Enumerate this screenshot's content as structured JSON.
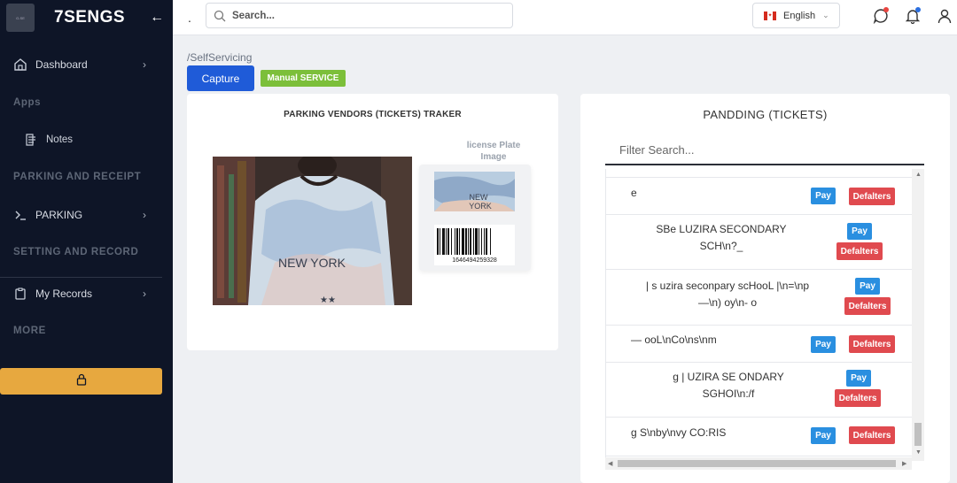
{
  "sidebar": {
    "brand": "7SENGS",
    "logo_text": "G-SE",
    "items": [
      {
        "label": "Dashboard"
      },
      {
        "label": "PARKING"
      },
      {
        "label": "My Records"
      }
    ],
    "sections": [
      "Apps",
      "PARKING AND RECEIPT",
      "SETTING AND RECORD",
      "MORE"
    ],
    "sub_items": [
      {
        "label": "Notes"
      }
    ]
  },
  "topbar": {
    "dot": ".",
    "search_placeholder": "Search...",
    "language": "English"
  },
  "main": {
    "breadcrumb": "/SelfServicing",
    "capture_label": "Capture",
    "manual_label": "Manual SERVICE",
    "left_card": {
      "title": "PARKING VENDORS (TICKETS) TRAKER",
      "plate_label": "license Plate Image",
      "barcode_number": "1646494259328",
      "shirt_text": "NEW YORK"
    },
    "right_card": {
      "title": "PANDDING (TICKETS)",
      "filter_placeholder": "Filter Search...",
      "pay_label": "Pay",
      "defaulters_label": "Defalters",
      "rows": [
        {
          "line1": "e",
          "line2": ""
        },
        {
          "line1": "SBe LUZIRA SECONDARY",
          "line2": "SCH\\n?_"
        },
        {
          "line1": "| s uzira seconpary scHooL |\\n=\\np",
          "line2": "—\\n) oy\\n- o"
        },
        {
          "line1": "— ooL\\nCo\\ns\\nm",
          "line2": ""
        },
        {
          "line1": "g | UZIRA SE ONDARY",
          "line2": "SGHOI\\n:/f"
        },
        {
          "line1": "g S\\nby\\nvy CO:RIS",
          "line2": ""
        }
      ]
    }
  },
  "colors": {
    "sidebar_bg": "#0e1527",
    "primary": "#1f5bd8",
    "success": "#7cbf3a",
    "pay": "#2a8fe0",
    "danger": "#e04a4f",
    "warning": "#e7a83f"
  }
}
